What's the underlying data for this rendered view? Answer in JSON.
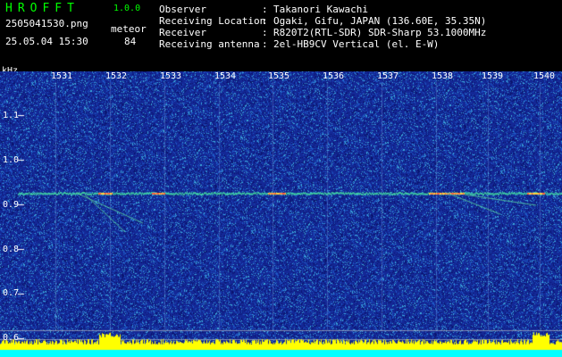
{
  "header": {
    "logo": "HROFFT",
    "version": "1.0.0",
    "filename": "2505041530.png",
    "mode_label": "meteor",
    "datetime": "25.05.04 15:30",
    "count": "84"
  },
  "info": {
    "labels": [
      "Observer",
      "Receiving Location",
      "Receiver",
      "Receiving antenna"
    ],
    "values": [
      "Takanori Kawachi",
      "Ogaki, Gifu, JAPAN (136.60E, 35.35N)",
      "R820T2(RTL-SDR) SDR-Sharp 53.1000MHz",
      "2el-HB9CV Vertical (el. E-W)"
    ]
  },
  "axes": {
    "y_unit": "kHz",
    "y_ticks": [
      "1.1",
      "1.0",
      "0.9",
      "0.8",
      "0.7",
      "0.6"
    ],
    "x_ticks": [
      "1531",
      "1532",
      "1533",
      "1534",
      "1535",
      "1536",
      "1537",
      "1538",
      "1539",
      "1540"
    ]
  },
  "colors": {
    "background": "#000000",
    "logo": "#00ff00",
    "spectrogram_base": "#1a2fa8",
    "signal_trace": "#3fd0a0",
    "power_bar": "#ffff00",
    "baseline": "#00ffff"
  }
}
